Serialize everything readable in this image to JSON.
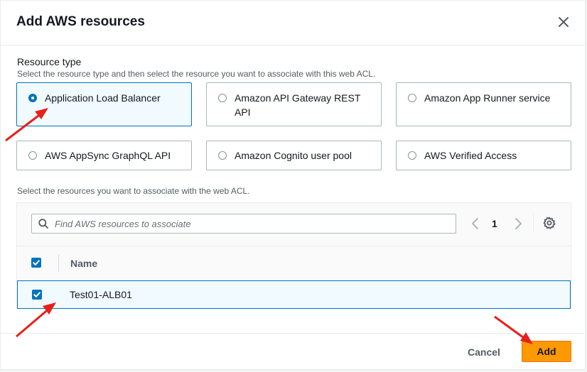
{
  "modal": {
    "title": "Add AWS resources",
    "close_icon": "close-icon"
  },
  "resource_type": {
    "label": "Resource type",
    "description": "Select the resource type and then select the resource you want to associate with this web ACL.",
    "selected": "Application Load Balancer",
    "options": [
      {
        "label": "Application Load Balancer",
        "selected": true
      },
      {
        "label": "Amazon API Gateway REST API",
        "selected": false
      },
      {
        "label": "Amazon App Runner service",
        "selected": false
      },
      {
        "label": "AWS AppSync GraphQL API",
        "selected": false
      },
      {
        "label": "Amazon Cognito user pool",
        "selected": false
      },
      {
        "label": "AWS Verified Access",
        "selected": false
      }
    ]
  },
  "resources": {
    "description": "Select the resources you want to associate with the web ACL.",
    "search": {
      "placeholder": "Find AWS resources to associate",
      "value": ""
    },
    "pagination": {
      "current_page": "1"
    },
    "columns": [
      "Name"
    ],
    "select_all_checked": true,
    "rows": [
      {
        "name": "Test01-ALB01",
        "checked": true
      }
    ]
  },
  "footer": {
    "cancel_label": "Cancel",
    "add_label": "Add"
  },
  "colors": {
    "accent": "#0073bb",
    "primary_button": "#ff9900",
    "annotation_arrow": "#e8201a"
  }
}
